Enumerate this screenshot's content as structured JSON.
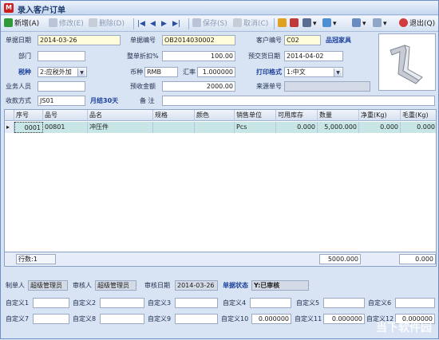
{
  "window": {
    "title": "录入客户订单",
    "icon_text": "M"
  },
  "toolbar": {
    "new": "新增(A)",
    "edit": "修改(E)",
    "delete": "删除(D)",
    "save": "保存(S)",
    "cancel": "取消(C)",
    "exit": "退出(Q)"
  },
  "form": {
    "order_date_label": "单据日期",
    "order_date": "2014-03-26",
    "order_no_label": "单据编号",
    "order_no": "OB2014030002",
    "customer_no_label": "客户编号",
    "customer_no": "C02",
    "customer_name": "品冠家具",
    "dept_label": "部门",
    "dept": "",
    "discount_label": "整单折扣%",
    "discount": "100.00",
    "delivery_label": "预交货日期",
    "delivery": "2014-04-02",
    "tax_label": "税种",
    "tax": "2:应税外加",
    "currency_label": "币种",
    "currency": "RMB",
    "rate_label": "汇率",
    "rate": "1.000000",
    "print_label": "打印格式",
    "print": "1:中文",
    "staff_label": "业务人员",
    "staff": "",
    "prepay_label": "预收金额",
    "prepay": "2000.00",
    "source_label": "来源单号",
    "source": "",
    "payment_label": "收款方式",
    "payment": "JS01",
    "payment_desc": "月结30天",
    "remark_label": "备    注",
    "remark": ""
  },
  "grid": {
    "headers": [
      "序号",
      "品号",
      "品名",
      "规格",
      "颜色",
      "销售单位",
      "可用库存",
      "数量",
      "净重(Kg)",
      "毛重(Kg)"
    ],
    "rows": [
      [
        "0001",
        "00801",
        "冲压件",
        "",
        "",
        "Pcs",
        "0.000",
        "5,000.000",
        "0.000",
        "0.000"
      ]
    ]
  },
  "summary": {
    "count_label": "行数:1",
    "qty_total": "5000.000",
    "gross_total": "0.000"
  },
  "footer": {
    "maker_label": "制单人",
    "maker": "超级管理员",
    "auditor_label": "审核人",
    "auditor": "超级管理员",
    "audit_date_label": "审核日期",
    "audit_date": "2014-03-26",
    "status_label": "单据状态",
    "status": "Y:已审核",
    "custom_labels": [
      "自定义1",
      "自定义2",
      "自定义3",
      "自定义4",
      "自定义5",
      "自定义6",
      "自定义7",
      "自定义8",
      "自定义9",
      "自定义10",
      "自定义11",
      "自定义12"
    ],
    "custom_values": [
      "",
      "",
      "",
      "",
      "",
      "",
      "",
      "",
      "",
      "0.000000",
      "0.000000",
      "0.000000"
    ]
  },
  "watermark": "当下软件园"
}
